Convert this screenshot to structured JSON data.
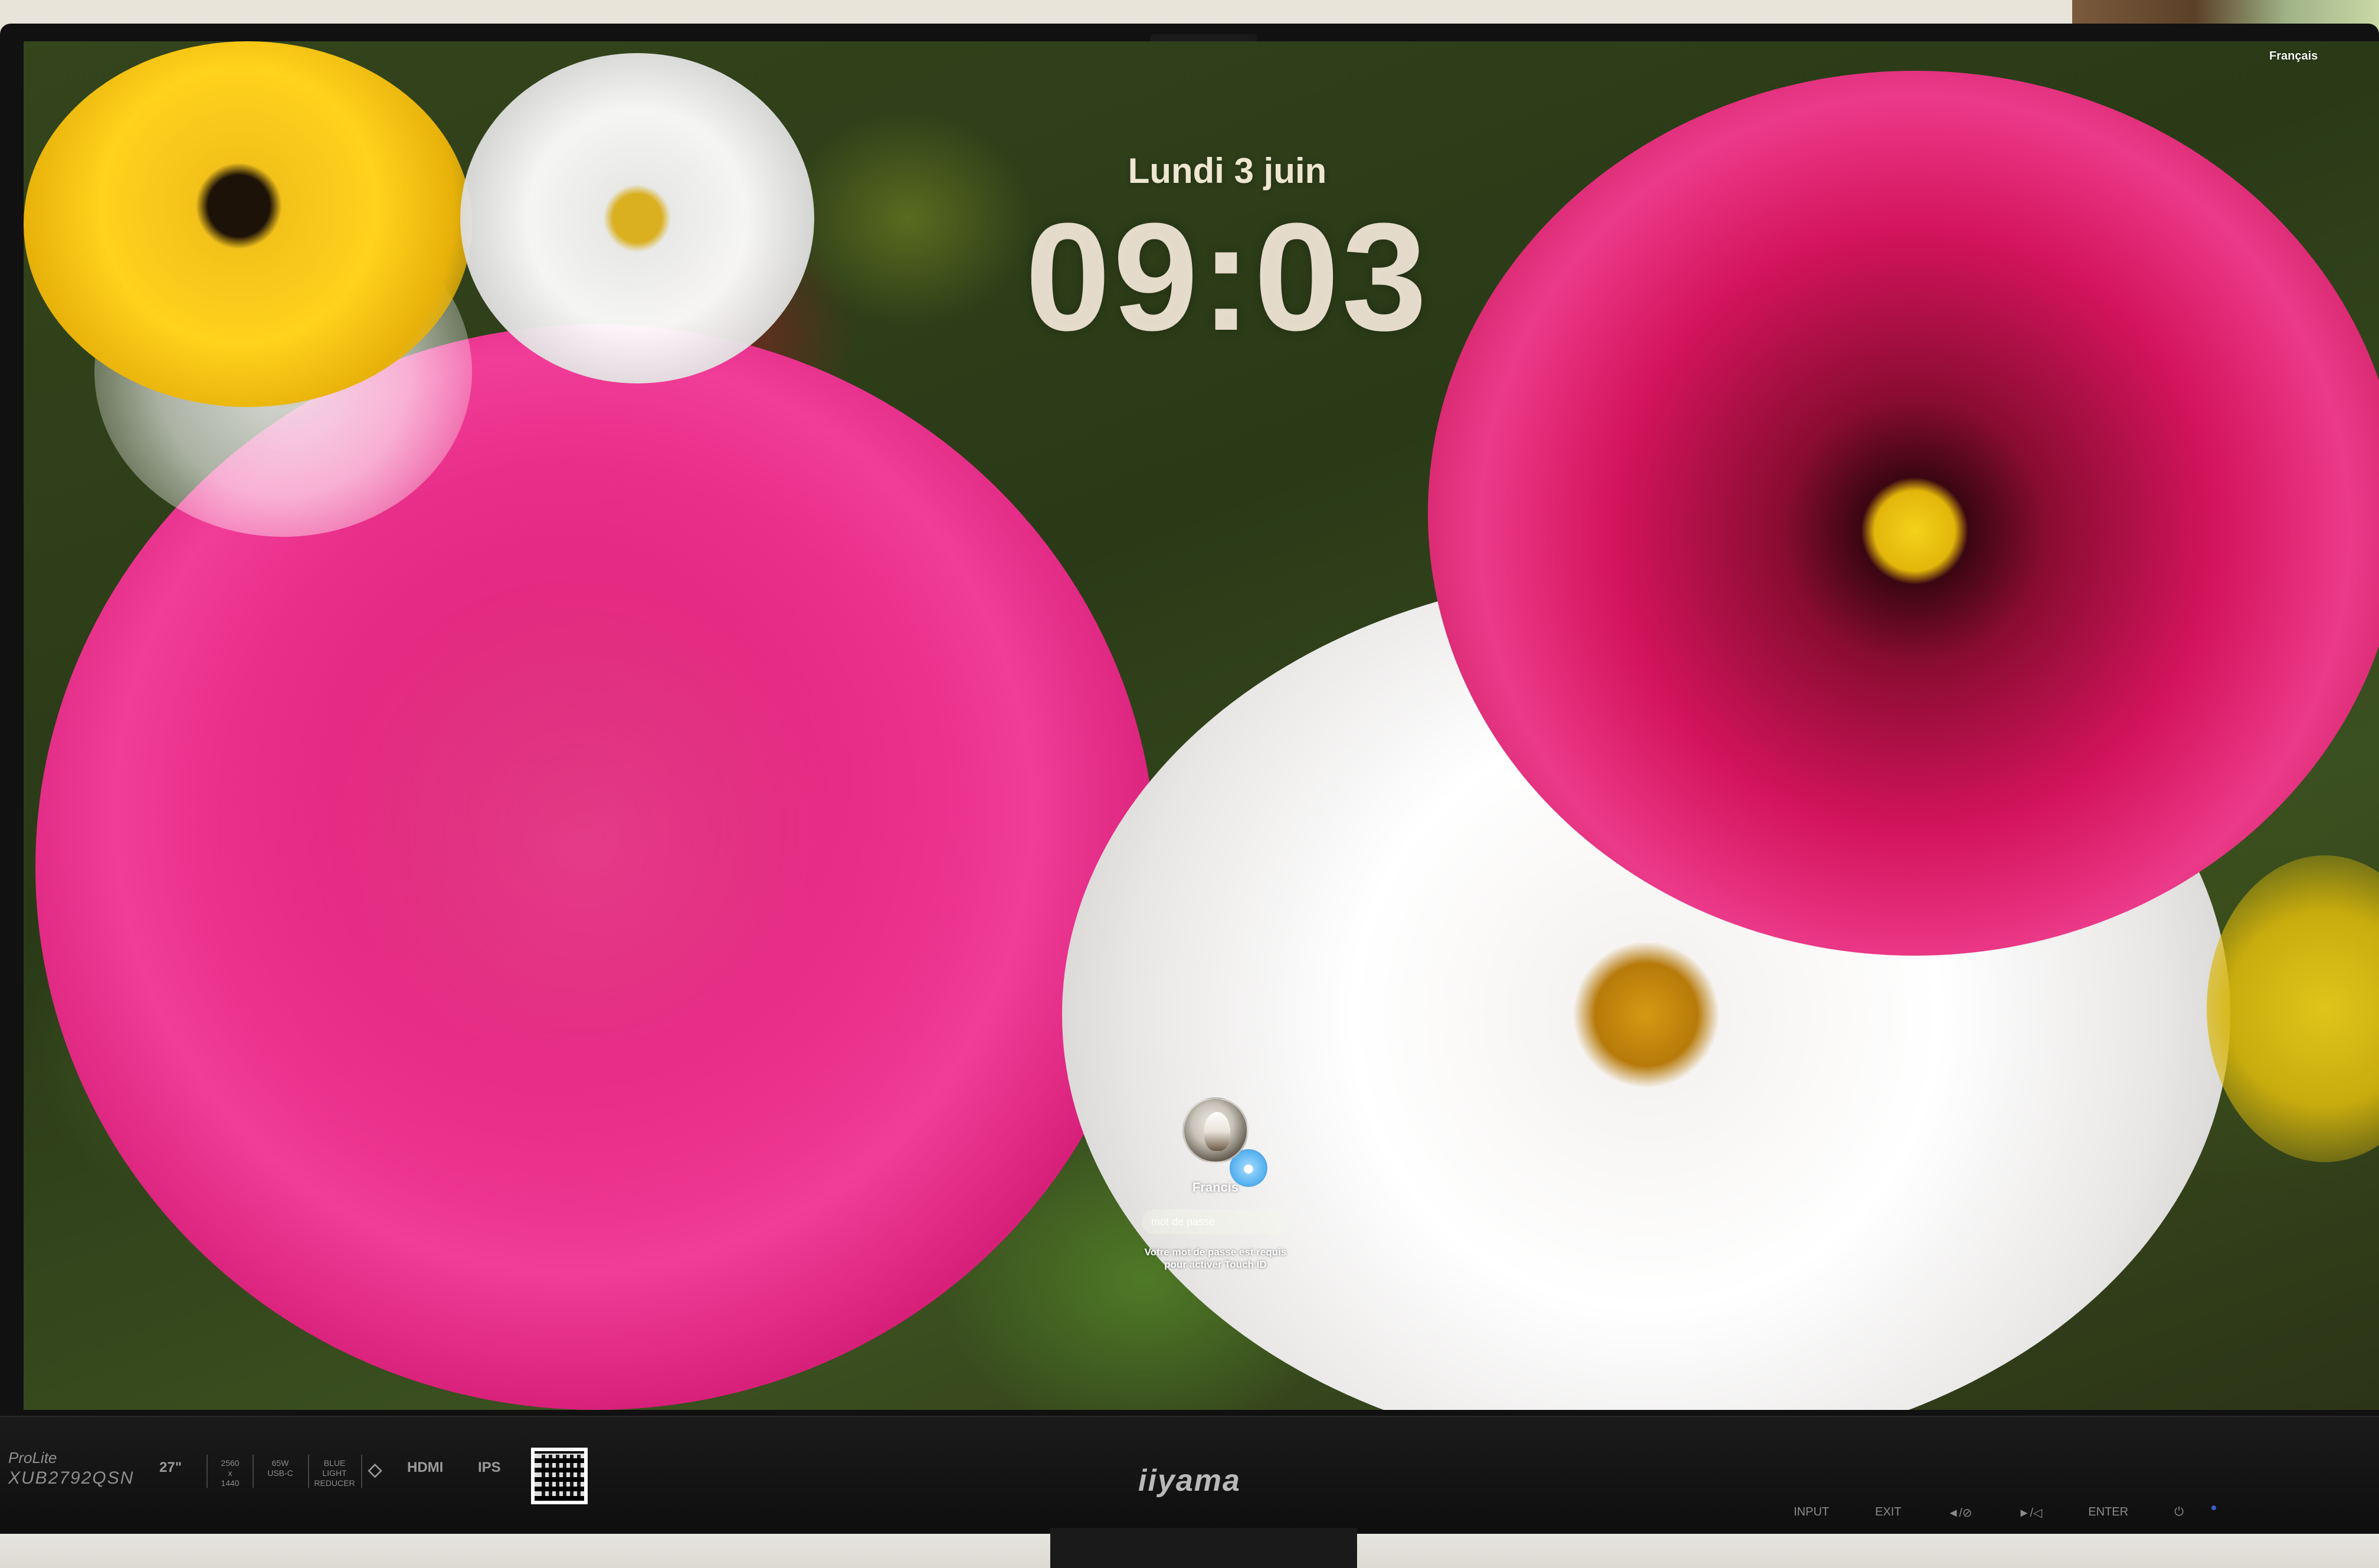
{
  "lock_screen": {
    "language_menu": "Français",
    "date": "Lundi 3 juin",
    "time": "09:03",
    "user": {
      "name": "Francis",
      "password_placeholder": "mot de passe",
      "hint_line1": "Votre mot de passe est requis",
      "hint_line2": "pour activer Touch ID"
    }
  },
  "monitor": {
    "series": "ProLite",
    "model": "XUB2792QSN",
    "size": "27\"",
    "resolution_top": "2560",
    "resolution_mid": "x",
    "resolution_bottom": "1440",
    "usbc_top": "65W",
    "usbc_bottom": "USB-C",
    "blue_light_top": "BLUE",
    "blue_light_mid": "LIGHT",
    "blue_light_bottom": "REDUCER",
    "hdmi": "HDMI",
    "panel": "IPS",
    "brand": "iiyama",
    "controls": [
      "INPUT",
      "EXIT",
      "◄/⊘",
      "►/◁",
      "ENTER",
      "⏻"
    ]
  },
  "colors": {
    "peony": "#e0217c",
    "cosmos": "#d4145c",
    "cosmos_center": "#f4d21a",
    "white_cosmos": "#ffffff",
    "daisy": "#ffd21c",
    "touch_badge": "#5ab4f0"
  },
  "icons": {
    "touch_id": "touch-id-badge-icon",
    "avatar": "user-avatar-icon"
  }
}
